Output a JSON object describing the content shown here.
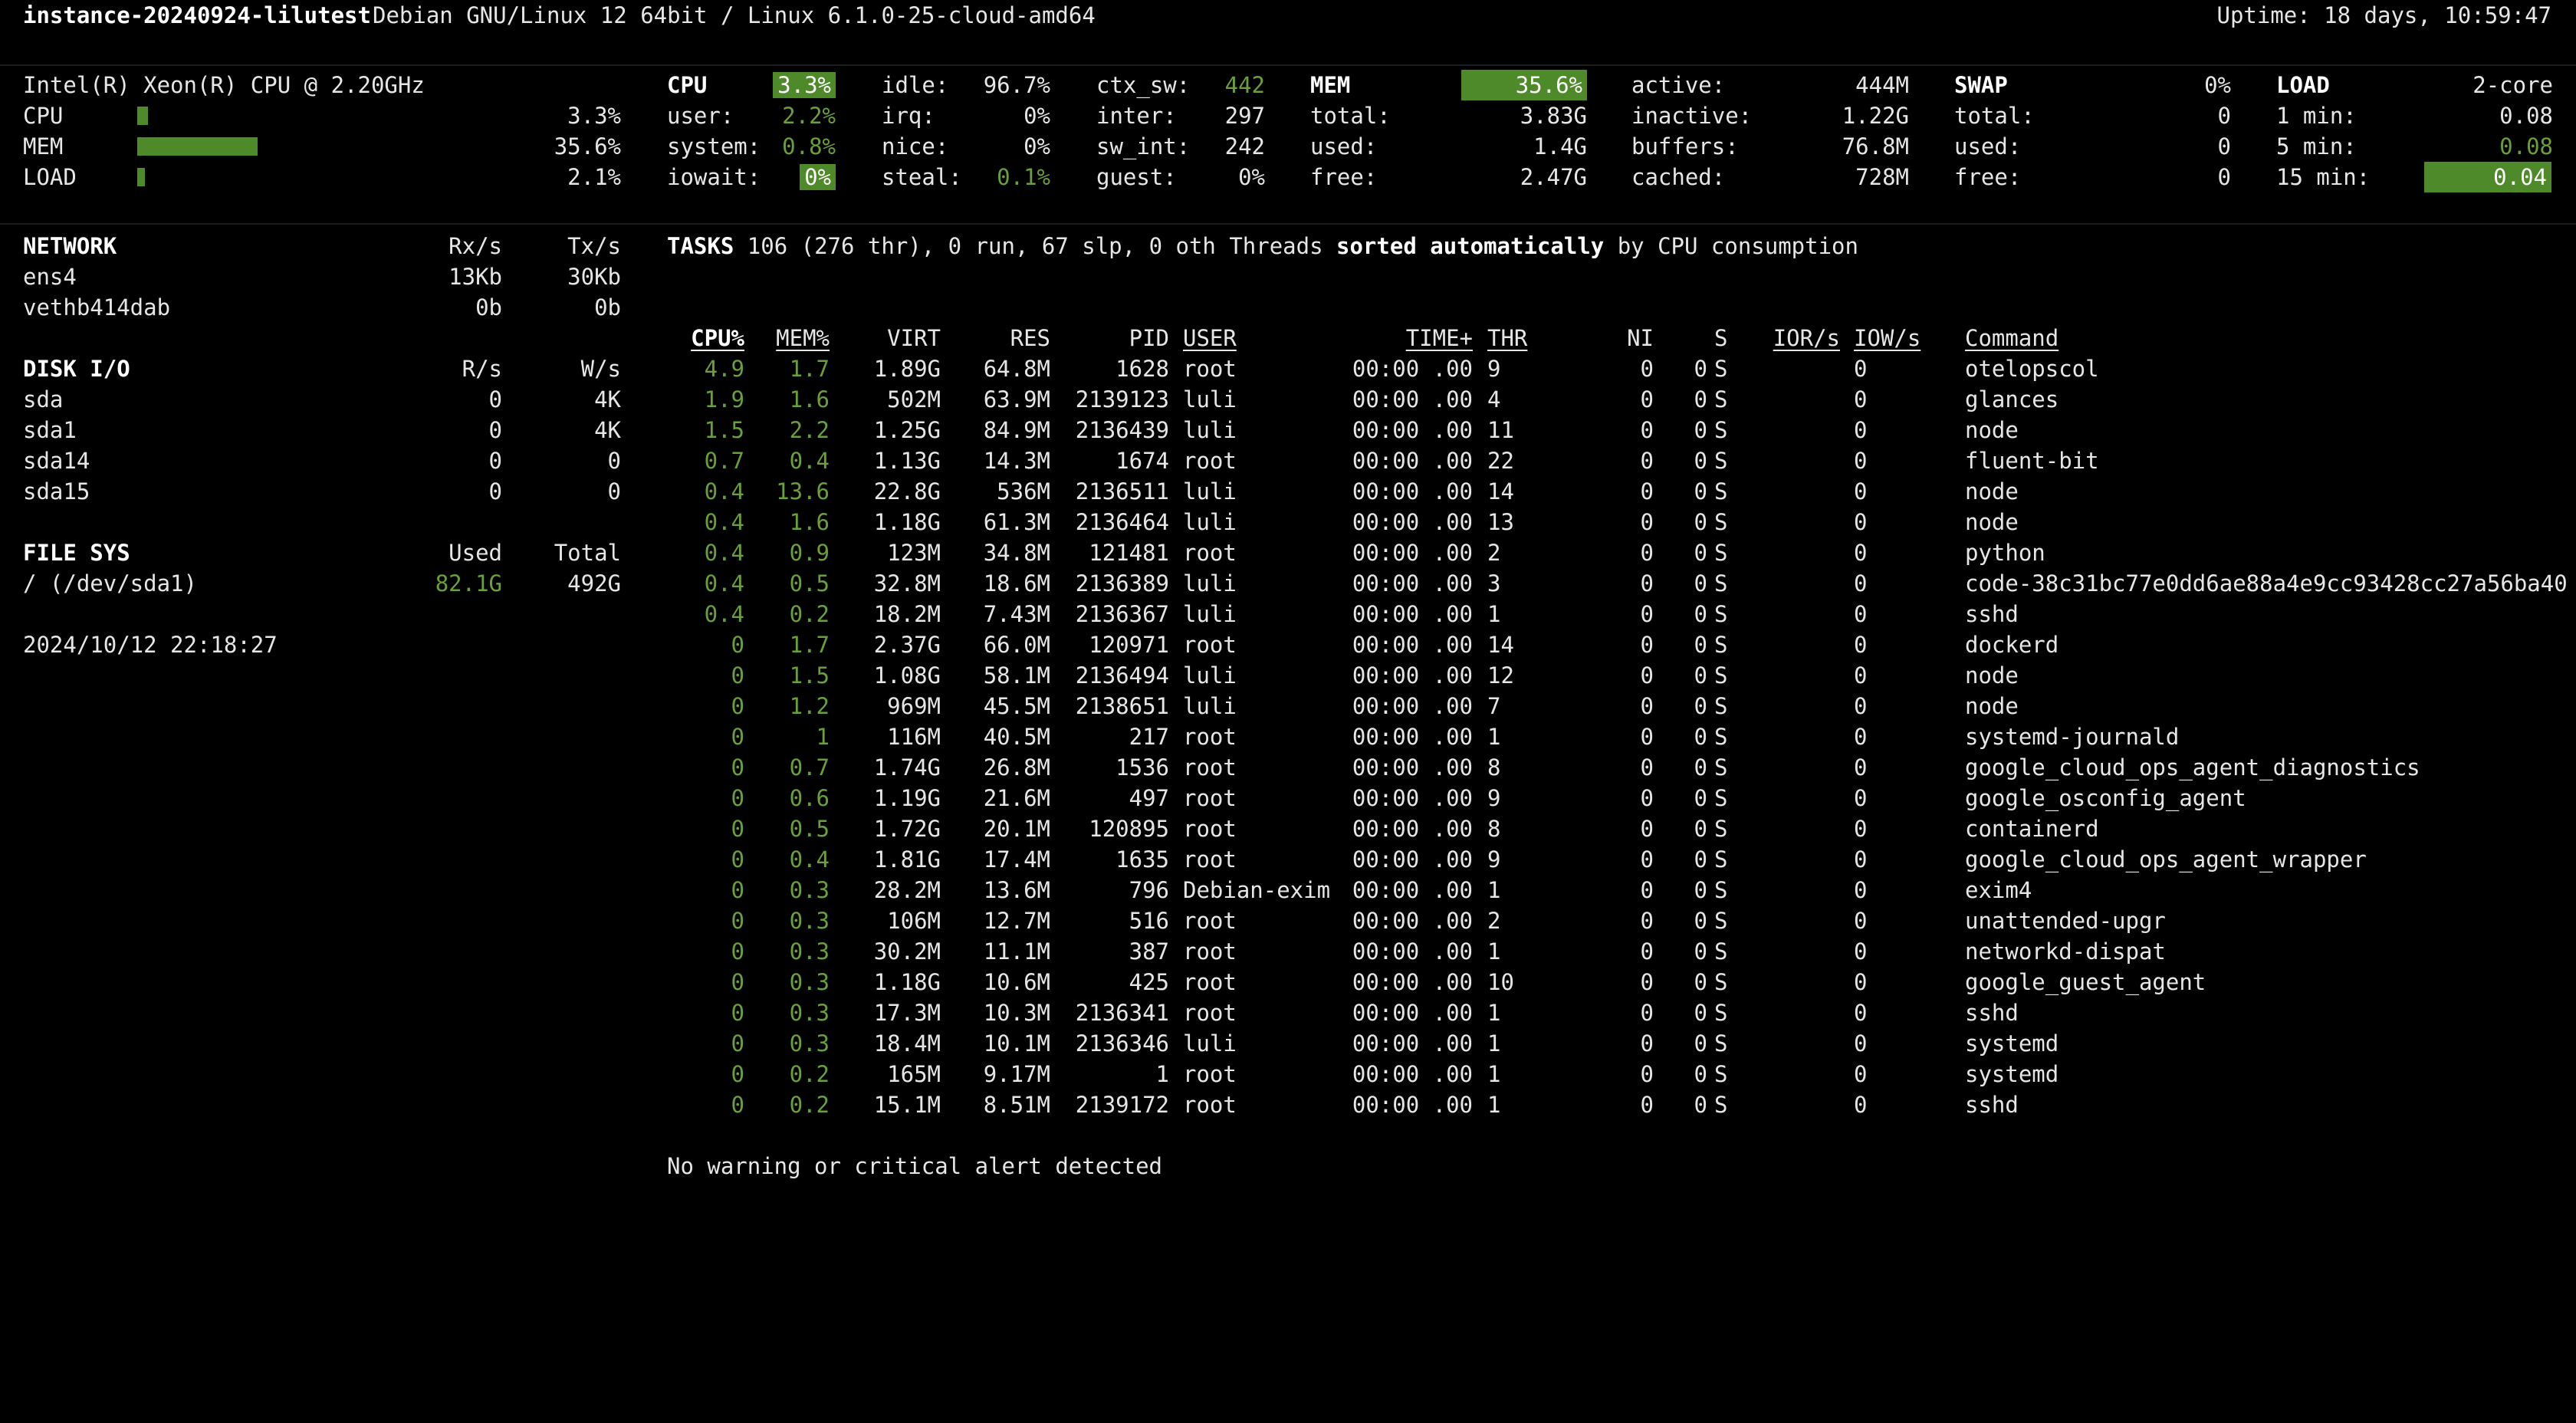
{
  "header": {
    "hostname": "instance-20240924-lilutest",
    "os": "Debian GNU/Linux 12 64bit / Linux 6.1.0-25-cloud-amd64",
    "uptime": "Uptime: 18 days, 10:59:47"
  },
  "quicklook": {
    "cpu_name": "Intel(R) Xeon(R) CPU @ 2.20GHz",
    "rows": [
      {
        "label": "CPU",
        "value": "3.3%",
        "percent": 3.3
      },
      {
        "label": "MEM",
        "value": "35.6%",
        "percent": 35.6
      },
      {
        "label": "LOAD",
        "value": "2.1%",
        "percent": 2.1
      }
    ]
  },
  "cpu": {
    "title": "CPU",
    "total": "3.3%",
    "user_label": "user:",
    "user": "2.2%",
    "system_label": "system:",
    "system": "0.8%",
    "iowait_label": "iowait:",
    "iowait": "0%",
    "idle_label": "idle:",
    "idle": "96.7%",
    "irq_label": "irq:",
    "irq": "0%",
    "nice_label": "nice:",
    "nice": "0%",
    "steal_label": "steal:",
    "steal": "0.1%",
    "ctx_label": "ctx_sw:",
    "ctx": "442",
    "inter_label": "inter:",
    "inter": "297",
    "swint_label": "sw_int:",
    "swint": "242",
    "guest_label": "guest:",
    "guest": "0%"
  },
  "mem": {
    "title": "MEM",
    "percent": "35.6%",
    "total_label": "total:",
    "total": "3.83G",
    "used_label": "used:",
    "used": "1.4G",
    "free_label": "free:",
    "free": "2.47G",
    "active_label": "active:",
    "active": "444M",
    "inactive_label": "inactive:",
    "inactive": "1.22G",
    "buffers_label": "buffers:",
    "buffers": "76.8M",
    "cached_label": "cached:",
    "cached": "728M"
  },
  "swap": {
    "title": "SWAP",
    "percent": "0%",
    "total_label": "total:",
    "total": "0",
    "used_label": "used:",
    "used": "0",
    "free_label": "free:",
    "free": "0"
  },
  "load": {
    "title": "LOAD",
    "cores": "2-core",
    "m1_label": "1 min:",
    "m1": "0.08",
    "m5_label": "5 min:",
    "m5": "0.08",
    "m15_label": "15 min:",
    "m15": "0.04"
  },
  "network": {
    "title": "NETWORK",
    "rx_header": "Rx/s",
    "tx_header": "Tx/s",
    "rows": [
      {
        "name": "ens4",
        "rx": "13Kb",
        "tx": "30Kb"
      },
      {
        "name": "vethb414dab",
        "rx": "0b",
        "tx": "0b"
      }
    ]
  },
  "diskio": {
    "title": "DISK I/O",
    "r_header": "R/s",
    "w_header": "W/s",
    "rows": [
      {
        "name": "sda",
        "r": "0",
        "w": "4K"
      },
      {
        "name": "sda1",
        "r": "0",
        "w": "4K"
      },
      {
        "name": "sda14",
        "r": "0",
        "w": "0"
      },
      {
        "name": "sda15",
        "r": "0",
        "w": "0"
      }
    ]
  },
  "filesys": {
    "title": "FILE SYS",
    "used_header": "Used",
    "total_header": "Total",
    "rows": [
      {
        "name": "/ (/dev/sda1)",
        "used": "82.1G",
        "total": "492G"
      }
    ]
  },
  "datetime": "2024/10/12 22:18:27",
  "tasks": {
    "label": "TASKS",
    "summary": "106 (276 thr), 0 run, 67 slp, 0 oth Threads",
    "sorted": "sorted automatically",
    "by": "by CPU consumption"
  },
  "process_headers": {
    "cpu": "CPU%",
    "mem": "MEM%",
    "virt": "VIRT",
    "res": "RES",
    "pid": "PID",
    "user": "USER",
    "time": "TIME+",
    "thr": "THR",
    "ni": "NI",
    "s": "S",
    "ior": "IOR/s",
    "iow": "IOW/s",
    "cmd": "Command"
  },
  "processes": [
    {
      "cpu": "4.9",
      "mem": "1.7",
      "virt": "1.89G",
      "res": "64.8M",
      "pid": "1628",
      "user": "root",
      "time": "00:00 .00",
      "thr": "9",
      "ni": "0",
      "s": "S",
      "ior": "0",
      "iow": "0",
      "cmd": "otelopscol"
    },
    {
      "cpu": "1.9",
      "mem": "1.6",
      "virt": "502M",
      "res": "63.9M",
      "pid": "2139123",
      "user": "luli",
      "time": "00:00 .00",
      "thr": "4",
      "ni": "0",
      "s": "S",
      "ior": "0",
      "iow": "0",
      "cmd": "glances"
    },
    {
      "cpu": "1.5",
      "mem": "2.2",
      "virt": "1.25G",
      "res": "84.9M",
      "pid": "2136439",
      "user": "luli",
      "time": "00:00 .00",
      "thr": "11",
      "ni": "0",
      "s": "S",
      "ior": "0",
      "iow": "0",
      "cmd": "node"
    },
    {
      "cpu": "0.7",
      "mem": "0.4",
      "virt": "1.13G",
      "res": "14.3M",
      "pid": "1674",
      "user": "root",
      "time": "00:00 .00",
      "thr": "22",
      "ni": "0",
      "s": "S",
      "ior": "0",
      "iow": "0",
      "cmd": "fluent-bit"
    },
    {
      "cpu": "0.4",
      "mem": "13.6",
      "virt": "22.8G",
      "res": "536M",
      "pid": "2136511",
      "user": "luli",
      "time": "00:00 .00",
      "thr": "14",
      "ni": "0",
      "s": "S",
      "ior": "0",
      "iow": "0",
      "cmd": "node"
    },
    {
      "cpu": "0.4",
      "mem": "1.6",
      "virt": "1.18G",
      "res": "61.3M",
      "pid": "2136464",
      "user": "luli",
      "time": "00:00 .00",
      "thr": "13",
      "ni": "0",
      "s": "S",
      "ior": "0",
      "iow": "0",
      "cmd": "node"
    },
    {
      "cpu": "0.4",
      "mem": "0.9",
      "virt": "123M",
      "res": "34.8M",
      "pid": "121481",
      "user": "root",
      "time": "00:00 .00",
      "thr": "2",
      "ni": "0",
      "s": "S",
      "ior": "0",
      "iow": "0",
      "cmd": "python"
    },
    {
      "cpu": "0.4",
      "mem": "0.5",
      "virt": "32.8M",
      "res": "18.6M",
      "pid": "2136389",
      "user": "luli",
      "time": "00:00 .00",
      "thr": "3",
      "ni": "0",
      "s": "S",
      "ior": "0",
      "iow": "0",
      "cmd": "code-38c31bc77e0dd6ae88a4e9cc93428cc27a56ba40"
    },
    {
      "cpu": "0.4",
      "mem": "0.2",
      "virt": "18.2M",
      "res": "7.43M",
      "pid": "2136367",
      "user": "luli",
      "time": "00:00 .00",
      "thr": "1",
      "ni": "0",
      "s": "S",
      "ior": "0",
      "iow": "0",
      "cmd": "sshd"
    },
    {
      "cpu": "0",
      "mem": "1.7",
      "virt": "2.37G",
      "res": "66.0M",
      "pid": "120971",
      "user": "root",
      "time": "00:00 .00",
      "thr": "14",
      "ni": "0",
      "s": "S",
      "ior": "0",
      "iow": "0",
      "cmd": "dockerd"
    },
    {
      "cpu": "0",
      "mem": "1.5",
      "virt": "1.08G",
      "res": "58.1M",
      "pid": "2136494",
      "user": "luli",
      "time": "00:00 .00",
      "thr": "12",
      "ni": "0",
      "s": "S",
      "ior": "0",
      "iow": "0",
      "cmd": "node"
    },
    {
      "cpu": "0",
      "mem": "1.2",
      "virt": "969M",
      "res": "45.5M",
      "pid": "2138651",
      "user": "luli",
      "time": "00:00 .00",
      "thr": "7",
      "ni": "0",
      "s": "S",
      "ior": "0",
      "iow": "0",
      "cmd": "node"
    },
    {
      "cpu": "0",
      "mem": "1",
      "virt": "116M",
      "res": "40.5M",
      "pid": "217",
      "user": "root",
      "time": "00:00 .00",
      "thr": "1",
      "ni": "0",
      "s": "S",
      "ior": "0",
      "iow": "0",
      "cmd": "systemd-journald"
    },
    {
      "cpu": "0",
      "mem": "0.7",
      "virt": "1.74G",
      "res": "26.8M",
      "pid": "1536",
      "user": "root",
      "time": "00:00 .00",
      "thr": "8",
      "ni": "0",
      "s": "S",
      "ior": "0",
      "iow": "0",
      "cmd": "google_cloud_ops_agent_diagnostics"
    },
    {
      "cpu": "0",
      "mem": "0.6",
      "virt": "1.19G",
      "res": "21.6M",
      "pid": "497",
      "user": "root",
      "time": "00:00 .00",
      "thr": "9",
      "ni": "0",
      "s": "S",
      "ior": "0",
      "iow": "0",
      "cmd": "google_osconfig_agent"
    },
    {
      "cpu": "0",
      "mem": "0.5",
      "virt": "1.72G",
      "res": "20.1M",
      "pid": "120895",
      "user": "root",
      "time": "00:00 .00",
      "thr": "8",
      "ni": "0",
      "s": "S",
      "ior": "0",
      "iow": "0",
      "cmd": "containerd"
    },
    {
      "cpu": "0",
      "mem": "0.4",
      "virt": "1.81G",
      "res": "17.4M",
      "pid": "1635",
      "user": "root",
      "time": "00:00 .00",
      "thr": "9",
      "ni": "0",
      "s": "S",
      "ior": "0",
      "iow": "0",
      "cmd": "google_cloud_ops_agent_wrapper"
    },
    {
      "cpu": "0",
      "mem": "0.3",
      "virt": "28.2M",
      "res": "13.6M",
      "pid": "796",
      "user": "Debian-exim",
      "time": "00:00 .00",
      "thr": "1",
      "ni": "0",
      "s": "S",
      "ior": "0",
      "iow": "0",
      "cmd": "exim4"
    },
    {
      "cpu": "0",
      "mem": "0.3",
      "virt": "106M",
      "res": "12.7M",
      "pid": "516",
      "user": "root",
      "time": "00:00 .00",
      "thr": "2",
      "ni": "0",
      "s": "S",
      "ior": "0",
      "iow": "0",
      "cmd": "unattended-upgr"
    },
    {
      "cpu": "0",
      "mem": "0.3",
      "virt": "30.2M",
      "res": "11.1M",
      "pid": "387",
      "user": "root",
      "time": "00:00 .00",
      "thr": "1",
      "ni": "0",
      "s": "S",
      "ior": "0",
      "iow": "0",
      "cmd": "networkd-dispat"
    },
    {
      "cpu": "0",
      "mem": "0.3",
      "virt": "1.18G",
      "res": "10.6M",
      "pid": "425",
      "user": "root",
      "time": "00:00 .00",
      "thr": "10",
      "ni": "0",
      "s": "S",
      "ior": "0",
      "iow": "0",
      "cmd": "google_guest_agent"
    },
    {
      "cpu": "0",
      "mem": "0.3",
      "virt": "17.3M",
      "res": "10.3M",
      "pid": "2136341",
      "user": "root",
      "time": "00:00 .00",
      "thr": "1",
      "ni": "0",
      "s": "S",
      "ior": "0",
      "iow": "0",
      "cmd": "sshd"
    },
    {
      "cpu": "0",
      "mem": "0.3",
      "virt": "18.4M",
      "res": "10.1M",
      "pid": "2136346",
      "user": "luli",
      "time": "00:00 .00",
      "thr": "1",
      "ni": "0",
      "s": "S",
      "ior": "0",
      "iow": "0",
      "cmd": "systemd"
    },
    {
      "cpu": "0",
      "mem": "0.2",
      "virt": "165M",
      "res": "9.17M",
      "pid": "1",
      "user": "root",
      "time": "00:00 .00",
      "thr": "1",
      "ni": "0",
      "s": "S",
      "ior": "0",
      "iow": "0",
      "cmd": "systemd"
    },
    {
      "cpu": "0",
      "mem": "0.2",
      "virt": "15.1M",
      "res": "8.51M",
      "pid": "2139172",
      "user": "root",
      "time": "00:00 .00",
      "thr": "1",
      "ni": "0",
      "s": "S",
      "ior": "0",
      "iow": "0",
      "cmd": "sshd"
    }
  ],
  "alert": "No warning or critical alert detected",
  "colors": {
    "accent_green": "#4e8a2a",
    "text_green": "#6a9f3a",
    "background": "#000000"
  }
}
